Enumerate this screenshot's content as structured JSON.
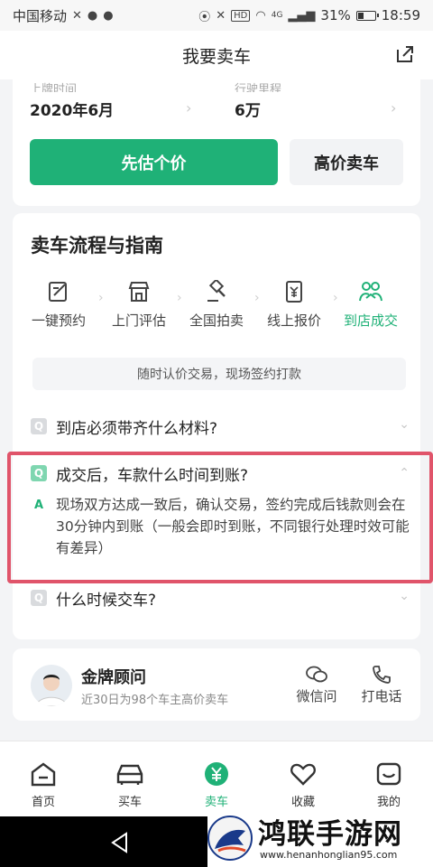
{
  "status_bar": {
    "carrier": "中国移动",
    "network": "4G",
    "battery": "31%",
    "time": "18:59",
    "hd": "HD"
  },
  "header": {
    "title": "我要卖车"
  },
  "car_info": {
    "reg_label": "上牌时间",
    "reg_value": "2020年6月",
    "mileage_label": "行驶里程",
    "mileage_value": "6万"
  },
  "actions": {
    "primary": "先估个价",
    "secondary": "高价卖车"
  },
  "guide": {
    "title": "卖车流程与指南",
    "steps": [
      {
        "label": "一键预约",
        "icon": "edit-icon"
      },
      {
        "label": "上门评估",
        "icon": "store-icon"
      },
      {
        "label": "全国拍卖",
        "icon": "gavel-icon"
      },
      {
        "label": "线上报价",
        "icon": "price-tag-icon"
      },
      {
        "label": "到店成交",
        "icon": "handshake-icon"
      }
    ],
    "tip": "随时认价交易，现场签约打款",
    "faqs": [
      {
        "q_badge": "Q",
        "question": "到店必须带齐什么材料?"
      },
      {
        "q_badge": "Q",
        "question": "成交后，车款什么时间到账?",
        "a_badge": "A",
        "answer": "现场双方达成一致后，确认交易，签约完成后钱款则会在30分钟内到账（一般会即时到账，不同银行处理时效可能有差异）"
      },
      {
        "q_badge": "Q",
        "question": "什么时候交车?"
      }
    ]
  },
  "advisor": {
    "title": "金牌顾问",
    "subtitle": "近30日为98个车主高价卖车",
    "wechat_label": "微信问",
    "call_label": "打电话"
  },
  "tabs": [
    {
      "label": "首页",
      "icon": "home-icon"
    },
    {
      "label": "买车",
      "icon": "car-icon"
    },
    {
      "label": "卖车",
      "icon": "yen-icon"
    },
    {
      "label": "收藏",
      "icon": "heart-icon"
    },
    {
      "label": "我的",
      "icon": "profile-icon"
    }
  ],
  "watermark": {
    "title": "鸿联手游网",
    "url": "www.henanhonglian95.com"
  },
  "colors": {
    "accent": "#1fb177",
    "highlight": "#e0546a"
  }
}
